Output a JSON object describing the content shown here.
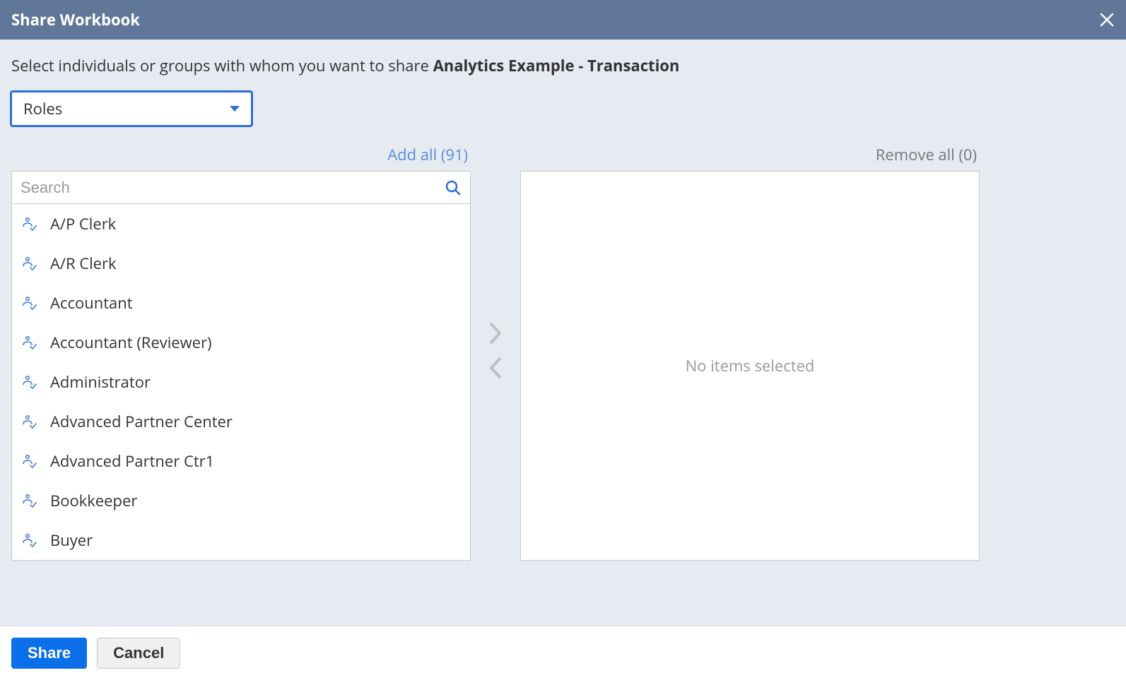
{
  "titlebar": {
    "title": "Share Workbook"
  },
  "instruction": {
    "prefix": "Select individuals or groups with whom you want to share ",
    "workbook_name": "Analytics Example - Transaction"
  },
  "dropdown": {
    "selected": "Roles"
  },
  "available": {
    "add_all_label": "Add all (91)",
    "search_placeholder": "Search",
    "items": [
      "A/P Clerk",
      "A/R Clerk",
      "Accountant",
      "Accountant (Reviewer)",
      "Administrator",
      "Advanced Partner Center",
      "Advanced Partner Ctr1",
      "Bookkeeper",
      "Buyer"
    ]
  },
  "selected": {
    "remove_all_label": "Remove all (0)",
    "empty_placeholder": "No items selected"
  },
  "footer": {
    "share": "Share",
    "cancel": "Cancel"
  }
}
